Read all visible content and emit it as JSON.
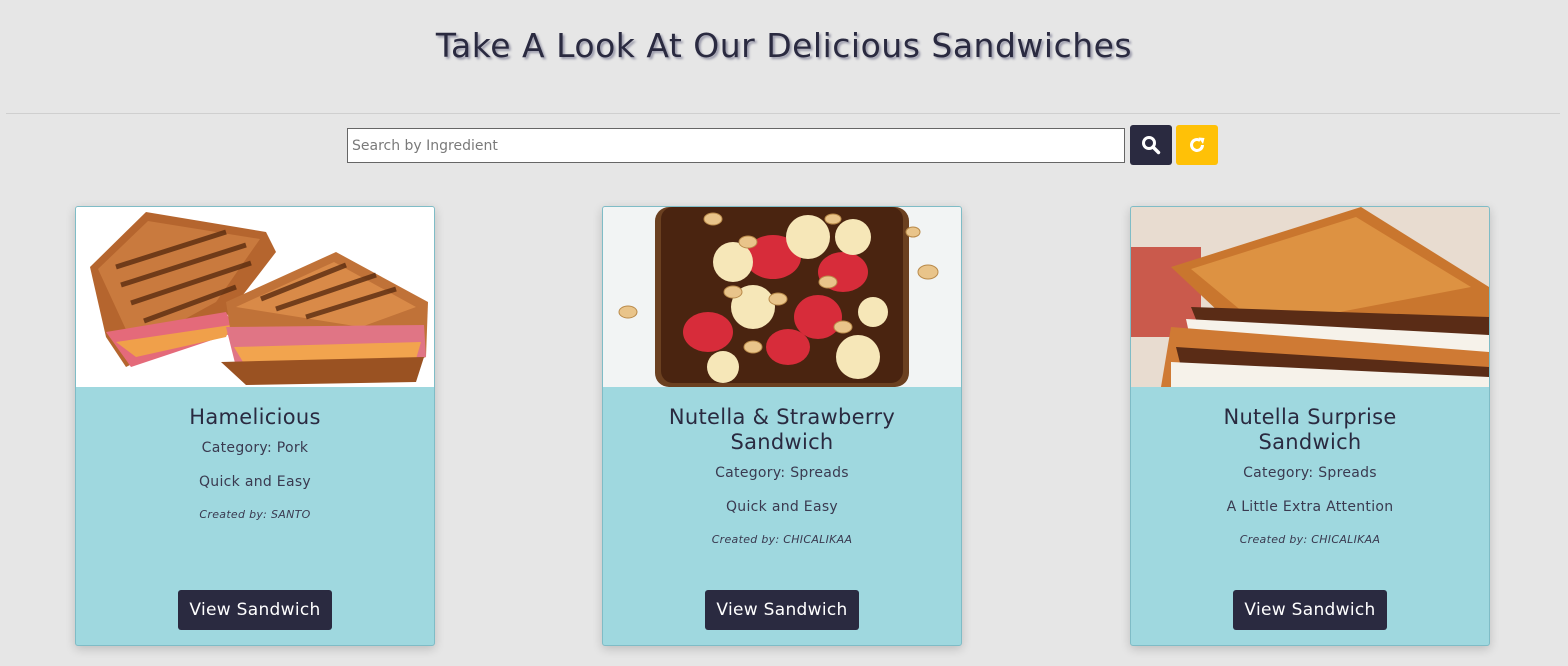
{
  "header": {
    "title": "Take A Look At Our Delicious Sandwiches"
  },
  "search": {
    "placeholder": "Search by Ingredient",
    "value": "",
    "search_icon": "search-icon",
    "reset_icon": "refresh-icon"
  },
  "colors": {
    "accent_dark": "#2a2a40",
    "accent_yellow": "#ffc107",
    "card_bg": "#9fd8df",
    "page_bg": "#e6e6e6"
  },
  "cards": [
    {
      "title": "Hamelicious",
      "category": "Category: Pork",
      "difficulty": "Quick and Easy",
      "created_by": "Created by: SANTO",
      "button": "View Sandwich"
    },
    {
      "title": "Nutella & Strawberry Sandwich",
      "category": "Category: Spreads",
      "difficulty": "Quick and Easy",
      "created_by": "Created by: CHICALIKAA",
      "button": "View Sandwich"
    },
    {
      "title": "Nutella Surprise Sandwich",
      "category": "Category: Spreads",
      "difficulty": "A Little Extra Attention",
      "created_by": "Created by: CHICALIKAA",
      "button": "View Sandwich"
    }
  ]
}
